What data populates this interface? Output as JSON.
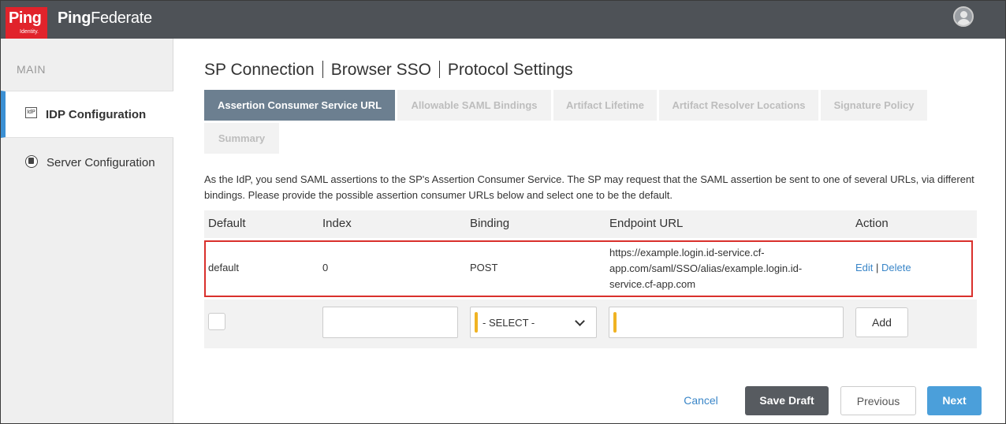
{
  "header": {
    "logo_word": "Ping",
    "logo_sub": "Identity.",
    "product_prefix": "Ping",
    "product_suffix": "Federate",
    "user_icon": "user-avatar-icon"
  },
  "sidebar": {
    "heading": "MAIN",
    "items": [
      {
        "label": "IDP Configuration",
        "icon": "idp-icon",
        "icon_text": "IdP",
        "active": true
      },
      {
        "label": "Server Configuration",
        "icon": "server-icon",
        "active": false
      }
    ]
  },
  "breadcrumb": [
    "SP Connection",
    "Browser SSO",
    "Protocol Settings"
  ],
  "tabs": [
    {
      "label": "Assertion Consumer Service URL",
      "active": true
    },
    {
      "label": "Allowable SAML Bindings",
      "active": false
    },
    {
      "label": "Artifact Lifetime",
      "active": false
    },
    {
      "label": "Artifact Resolver Locations",
      "active": false
    },
    {
      "label": "Signature Policy",
      "active": false
    },
    {
      "label": "Summary",
      "active": false
    }
  ],
  "description": "As the IdP, you send SAML assertions to the SP's Assertion Consumer Service. The SP may request that the SAML assertion be sent to one of several URLs, via different bindings. Please provide the possible assertion consumer URLs below and select one to be the default.",
  "table": {
    "columns": [
      "Default",
      "Index",
      "Binding",
      "Endpoint URL",
      "Action"
    ],
    "rows": [
      {
        "default": "default",
        "index": "0",
        "binding": "POST",
        "endpoint_lines": [
          "https://example.login.id-service.cf-",
          "app.com/saml/SSO/alias/example.login.id-",
          "service.cf-app.com"
        ],
        "edit": "Edit",
        "separator": "|",
        "delete": "Delete"
      }
    ],
    "new_row": {
      "index_value": "",
      "binding_select": "- SELECT -",
      "endpoint_value": "",
      "add_label": "Add"
    }
  },
  "footer": {
    "cancel": "Cancel",
    "save_draft": "Save Draft",
    "previous": "Previous",
    "next": "Next"
  },
  "colors": {
    "header_bg": "#4e5257",
    "brand_red": "#e1232b",
    "active_tab": "#6c7f90",
    "nav_accent": "#3a8fd3",
    "highlight_border": "#d9302c",
    "required_marker": "#f0b323",
    "next_button": "#4b9fda"
  }
}
